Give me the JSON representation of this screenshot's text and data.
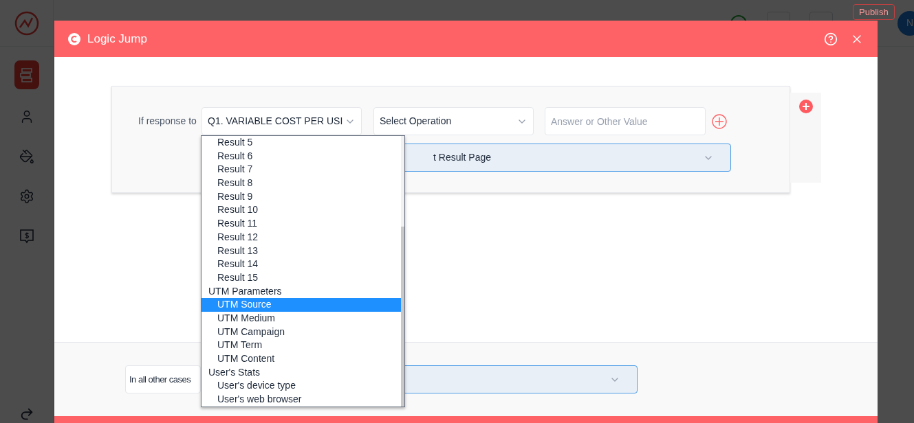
{
  "app": {
    "publish": "Publish",
    "avatar": "N"
  },
  "sidebar": {
    "items": [
      {
        "kind": "questions",
        "selected": true
      },
      {
        "kind": "user",
        "selected": false
      },
      {
        "kind": "paint",
        "selected": false
      },
      {
        "kind": "settings",
        "selected": false
      },
      {
        "kind": "pricing",
        "selected": false
      }
    ]
  },
  "modal": {
    "title": "Logic Jump",
    "rule": {
      "label": "If response to",
      "question": "Q1. VARIABLE COST PER USI",
      "operation": "Select Operation",
      "value_placeholder": "Answer or Other Value",
      "result_page": "t Result Page"
    },
    "question_list": {
      "items": [
        {
          "label": "Result 5",
          "kind": "option",
          "selected": false
        },
        {
          "label": "Result 6",
          "kind": "option",
          "selected": false
        },
        {
          "label": "Result 7",
          "kind": "option",
          "selected": false
        },
        {
          "label": "Result 8",
          "kind": "option",
          "selected": false
        },
        {
          "label": "Result 9",
          "kind": "option",
          "selected": false
        },
        {
          "label": "Result 10",
          "kind": "option",
          "selected": false
        },
        {
          "label": "Result 11",
          "kind": "option",
          "selected": false
        },
        {
          "label": "Result 12",
          "kind": "option",
          "selected": false
        },
        {
          "label": "Result 13",
          "kind": "option",
          "selected": false
        },
        {
          "label": "Result 14",
          "kind": "option",
          "selected": false
        },
        {
          "label": "Result 15",
          "kind": "option",
          "selected": false
        },
        {
          "label": "UTM Parameters",
          "kind": "group",
          "selected": false
        },
        {
          "label": "UTM Source",
          "kind": "option",
          "selected": true
        },
        {
          "label": "UTM Medium",
          "kind": "option",
          "selected": false
        },
        {
          "label": "UTM Campaign",
          "kind": "option",
          "selected": false
        },
        {
          "label": "UTM Term",
          "kind": "option",
          "selected": false
        },
        {
          "label": "UTM Content",
          "kind": "option",
          "selected": false
        },
        {
          "label": "User's Stats",
          "kind": "group",
          "selected": false
        },
        {
          "label": "User's device type",
          "kind": "option",
          "selected": false
        },
        {
          "label": "User's web browser",
          "kind": "option",
          "selected": false
        }
      ]
    },
    "fallback": {
      "label": "In all other cases"
    }
  }
}
